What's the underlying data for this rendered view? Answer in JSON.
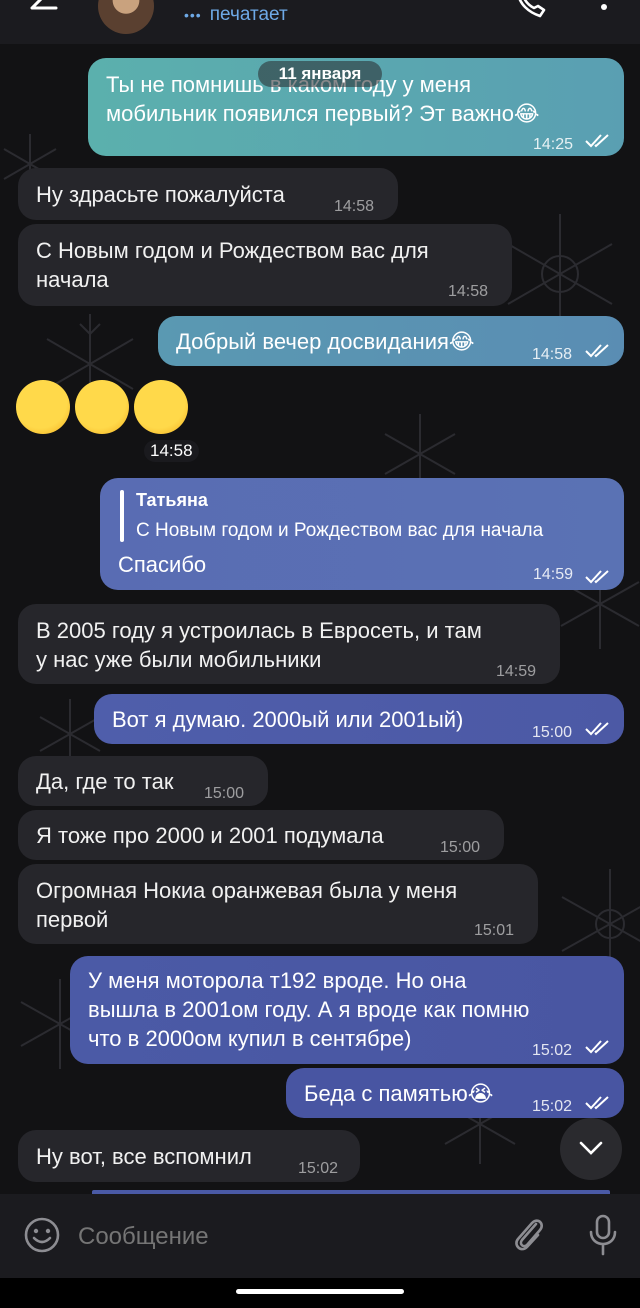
{
  "header": {
    "status_text": "печатает",
    "typing_dots": "•••"
  },
  "date_pill": "11 января",
  "messages": [
    {
      "dir": "out",
      "text": "Ты не помнишь в каком году у меня\nмобильник появился первый? Эт важно😂",
      "time": "14:25",
      "read": true
    },
    {
      "dir": "in",
      "text": "Ну здрасьте пожалуйста",
      "time": "14:58"
    },
    {
      "dir": "in",
      "text": "С Новым годом и Рождеством вас для\nначала",
      "time": "14:58"
    },
    {
      "dir": "out",
      "text": "Добрый вечер досвидания😂",
      "time": "14:58",
      "read": true
    },
    {
      "dir": "in",
      "type": "emoji",
      "emoji": "😅😅😅",
      "time": "14:58"
    },
    {
      "dir": "out",
      "reply_name": "Татьяна",
      "reply_text": "С Новым годом и Рождеством вас для начала",
      "text": "Спасибо",
      "time": "14:59",
      "read": true
    },
    {
      "dir": "in",
      "text": "В 2005 году я устроилась в Евросеть, и там\nу нас уже были мобильники",
      "time": "14:59"
    },
    {
      "dir": "out",
      "text": "Вот я думаю. 2000ый или 2001ый)",
      "time": "15:00",
      "read": true
    },
    {
      "dir": "in",
      "text": "Да, где то так",
      "time": "15:00"
    },
    {
      "dir": "in",
      "text": "Я тоже про 2000 и 2001 подумала",
      "time": "15:00"
    },
    {
      "dir": "in",
      "text": "Огромная Нокиа оранжевая была у меня\nпервой",
      "time": "15:01"
    },
    {
      "dir": "out",
      "text": "У меня моторола т192 вроде. Но она\nвышла в 2001ом году. А я вроде как помню\nчто в 2000ом купил в сентябре)",
      "time": "15:02",
      "read": true
    },
    {
      "dir": "out",
      "text": "Беда с памятью😭",
      "time": "15:02",
      "read": true
    },
    {
      "dir": "in",
      "text": "Ну вот, все вспомнил",
      "time": "15:02"
    }
  ],
  "input": {
    "placeholder": "Сообщение"
  },
  "icons": [
    "back-arrow-icon",
    "phone-icon",
    "more-vert-icon",
    "emoji-icon",
    "attach-icon",
    "mic-icon",
    "chevron-down-icon",
    "double-check-icon"
  ],
  "colors": {
    "incoming": "#26262b",
    "outgoing_top": "#5ba3a8",
    "outgoing_bottom": "#4a5aa6",
    "accent": "#6ea9e6"
  }
}
